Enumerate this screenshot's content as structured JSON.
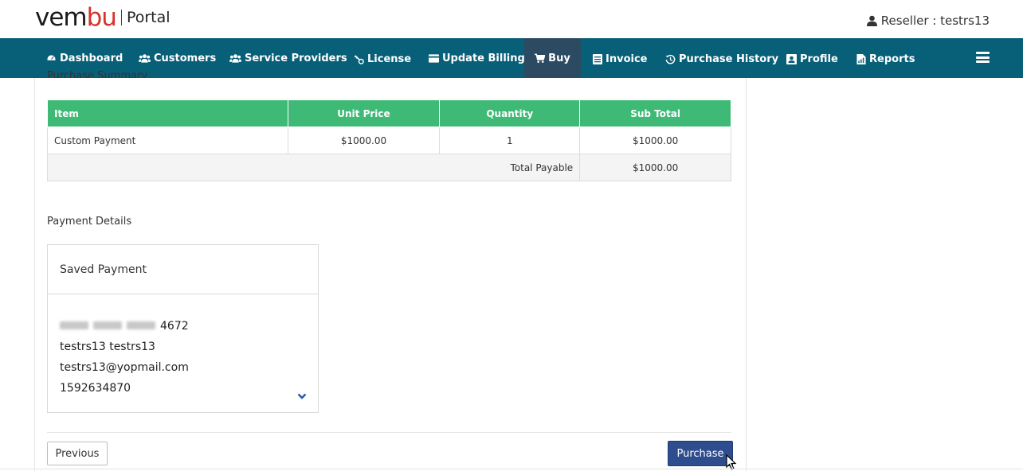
{
  "header": {
    "logo_pre": "vem",
    "logo_accent": "bu",
    "logo_portal": "Portal",
    "user_label": "Reseller : testrs13"
  },
  "nav": {
    "dashboard": "Dashboard",
    "customers": "Customers",
    "service_providers": "Service Providers",
    "license": "License",
    "update_billing": "Update Billing",
    "buy": "Buy",
    "invoice": "Invoice",
    "purchase_history": "Purchase History",
    "profile": "Profile",
    "reports": "Reports"
  },
  "summary": {
    "title": "Purchase Summary",
    "headers": {
      "item": "Item",
      "unit_price": "Unit Price",
      "quantity": "Quantity",
      "sub_total": "Sub Total"
    },
    "row": {
      "item": "Custom Payment",
      "unit_price": "$1000.00",
      "quantity": "1",
      "sub_total": "$1000.00"
    },
    "total_label": "Total Payable",
    "total_value": "$1000.00"
  },
  "payment": {
    "label": "Payment Details",
    "card_title": "Saved Payment",
    "card_last4": "4672",
    "name": "testrs13 testrs13",
    "email": "testrs13@yopmail.com",
    "phone": "1592634870"
  },
  "actions": {
    "previous": "Previous",
    "purchase": "Purchase"
  },
  "colors": {
    "nav_bg": "#085f78",
    "nav_active": "#2d4a63",
    "table_header": "#3fba76",
    "total_red": "#c0142b",
    "purchase_btn": "#2e4d8f"
  }
}
